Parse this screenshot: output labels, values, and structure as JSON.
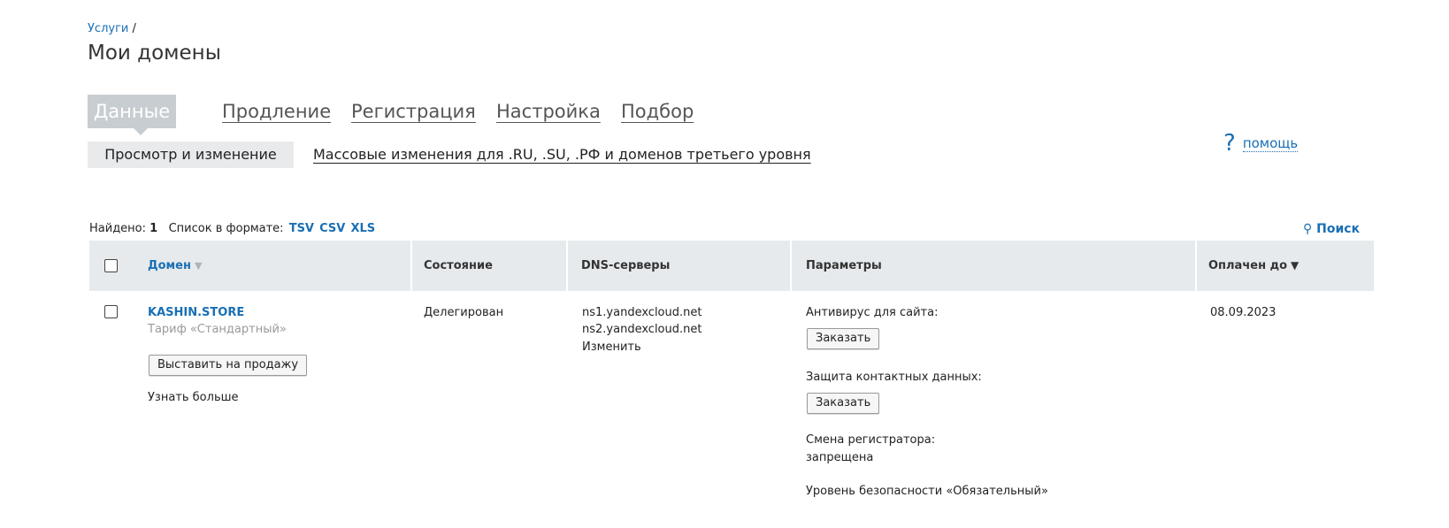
{
  "breadcrumb": {
    "link": "Услуги",
    "separator": "/"
  },
  "page_title": "Мои домены",
  "tabs": [
    {
      "label": "Данные",
      "active": true
    },
    {
      "label": "Продление"
    },
    {
      "label": "Регистрация"
    },
    {
      "label": "Настройка"
    },
    {
      "label": "Подбор"
    }
  ],
  "subtabs": {
    "active": "Просмотр и изменение",
    "link": "Массовые изменения для .RU, .SU, .РФ и доменов третьего уровня"
  },
  "help": {
    "icon": "?",
    "label": "помощь"
  },
  "found": {
    "label": "Найдено:",
    "count": "1",
    "format_label": "Список в формате:",
    "formats": [
      "TSV",
      "CSV",
      "XLS"
    ]
  },
  "search": {
    "label": "Поиск",
    "icon": "search-icon"
  },
  "table": {
    "headers": {
      "domain": "Домен",
      "status": "Состояние",
      "dns": "DNS-серверы",
      "params": "Параметры",
      "paid_until": "Оплачен до"
    },
    "row": {
      "domain": "KASHIN.STORE",
      "tariff": "Тариф «Стандартный»",
      "sell_button": "Выставить на продажу",
      "learn_more": "Узнать больше",
      "status": "Делегирован",
      "dns1": "ns1.yandexcloud.net",
      "dns2": "ns2.yandexcloud.net",
      "dns_change": "Изменить",
      "antivirus_label": "Антивирус для сайта:",
      "antivirus_button": "Заказать",
      "privacy_label": "Защита контактных данных:",
      "privacy_button": "Заказать",
      "registrar_change_label": "Смена регистратора:",
      "registrar_change_value": "запрещена",
      "security_level": "Уровень безопасности «Обязательный»",
      "paid_until": "08.09.2023"
    }
  }
}
